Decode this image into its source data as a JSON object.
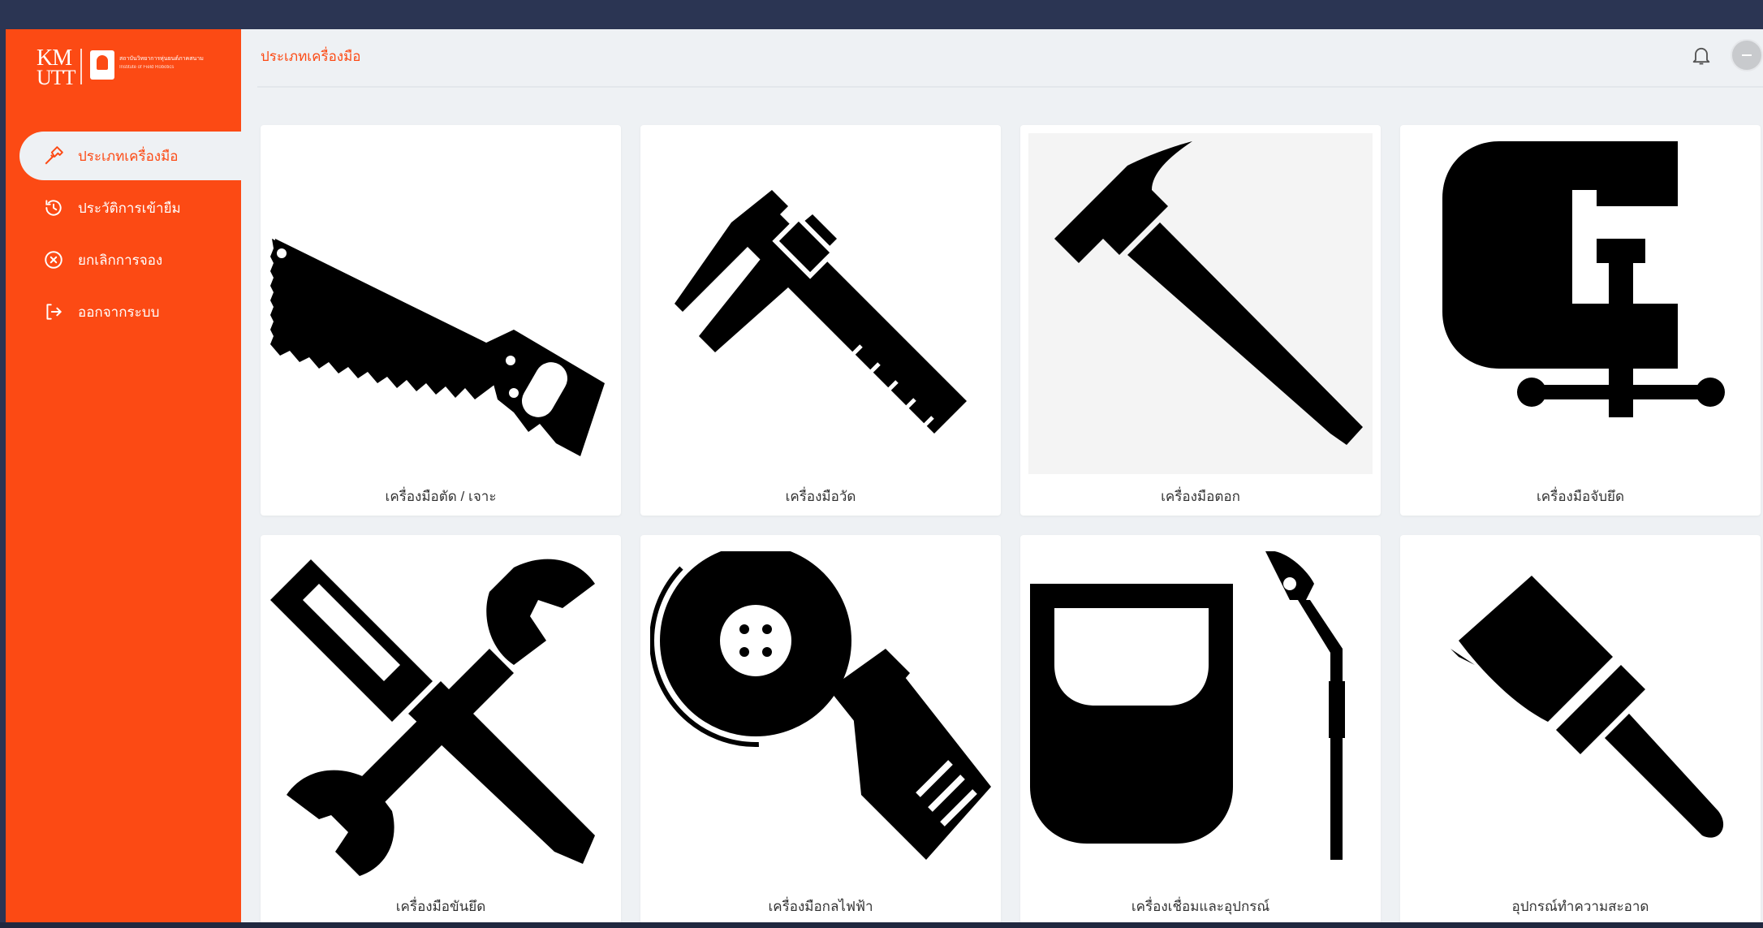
{
  "logo": {
    "line1": "KM",
    "line2": "UTT",
    "institute_th": "สถาบันวิทยาการหุ่นยนต์ภาคสนาม",
    "institute_en": "Institute of Field Robotics"
  },
  "sidebar": {
    "items": [
      {
        "label": "ประเภทเครื่องมือ",
        "icon": "hammer-icon",
        "active": true
      },
      {
        "label": "ประวัติการเข้ายืม",
        "icon": "history-icon",
        "active": false
      },
      {
        "label": "ยกเลิกการจอง",
        "icon": "cancel-circle-icon",
        "active": false
      },
      {
        "label": "ออกจากระบบ",
        "icon": "logout-icon",
        "active": false
      }
    ]
  },
  "header": {
    "title": "ประเภทเครื่องมือ",
    "bell_icon": "bell-icon",
    "avatar_icon": "avatar"
  },
  "categories": [
    {
      "label": "เครื่องมือตัด / เจาะ",
      "icon": "saw-icon"
    },
    {
      "label": "เครื่องมือวัด",
      "icon": "caliper-icon"
    },
    {
      "label": "เครื่องมือตอก",
      "icon": "hammer-icon"
    },
    {
      "label": "เครื่องมือจับยึด",
      "icon": "clamp-icon"
    },
    {
      "label": "เครื่องมือขันยึด",
      "icon": "screwdriver-wrench-icon"
    },
    {
      "label": "เครื่องมือกลไฟฟ้า",
      "icon": "angle-grinder-icon"
    },
    {
      "label": "เครื่องเชื่อมและอุปกรณ์",
      "icon": "welding-icon"
    },
    {
      "label": "อุปกรณ์ทำความสะอาด",
      "icon": "paintbrush-icon"
    }
  ],
  "colors": {
    "accent": "#fc4a14",
    "background": "#eef1f4",
    "frame": "#2b3553"
  }
}
